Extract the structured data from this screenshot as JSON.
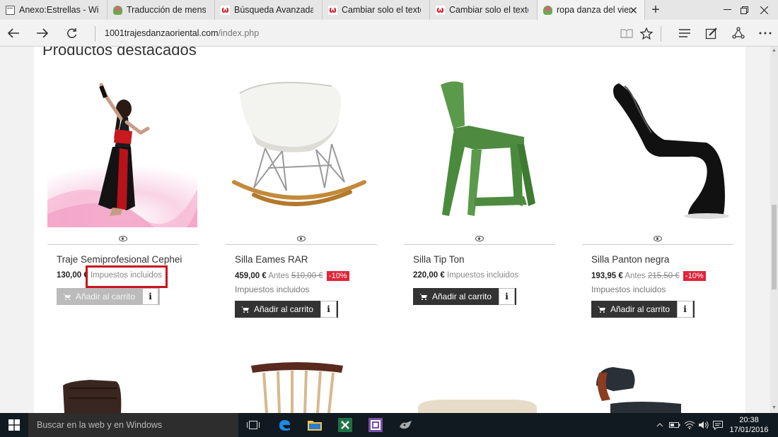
{
  "browser": {
    "tabs": [
      {
        "title": "Anexo:Estrellas - Wikipe",
        "favicon": "page-icon"
      },
      {
        "title": "Traducción de mensaje:",
        "favicon": "leaf-icon"
      },
      {
        "title": "Búsqueda Avanzada",
        "favicon": "w-logo-icon"
      },
      {
        "title": "Cambiar solo el texto \"i",
        "favicon": "w-logo-icon"
      },
      {
        "title": "Cambiar solo el texto \"i",
        "favicon": "w-logo-icon"
      },
      {
        "title": "ropa danza del vien",
        "favicon": "leaf-icon",
        "active": true
      }
    ],
    "url_host": "1001trajesdanzaoriental.com",
    "url_path": "/index.php"
  },
  "page": {
    "section_title": "Productos destacados",
    "products": [
      {
        "name": "Traje Semiprofesional Cephei",
        "price": "130,00 €",
        "tax_inline": "Impuestos incluidos",
        "button": "Añadir al carrito",
        "button_enabled": false,
        "info": "i"
      },
      {
        "name": "Silla Eames RAR",
        "price": "459,00 €",
        "antes_label": "Antes",
        "old_price": "510,00 €",
        "discount": "-10%",
        "tax": "Impuestos incluidos",
        "button": "Añadir al carrito",
        "button_enabled": true,
        "info": "i"
      },
      {
        "name": "Silla Tip Ton",
        "price": "220,00 €",
        "tax_inline": "Impuestos incluidos",
        "button": "Añadir al carrito",
        "button_enabled": true,
        "info": "i"
      },
      {
        "name": "Silla Panton negra",
        "price": "193,95 €",
        "antes_label": "Antes",
        "old_price": "215,50 €",
        "discount": "-10%",
        "tax": "Impuestos incluidos",
        "button": "Añadir al carrito",
        "button_enabled": true,
        "info": "i"
      }
    ]
  },
  "taskbar": {
    "search_placeholder": "Buscar en la web y en Windows",
    "time": "20:38",
    "date": "17/01/2016"
  },
  "colors": {
    "discount": "#e0253a",
    "highlight": "#c8141c",
    "button": "#333333"
  }
}
